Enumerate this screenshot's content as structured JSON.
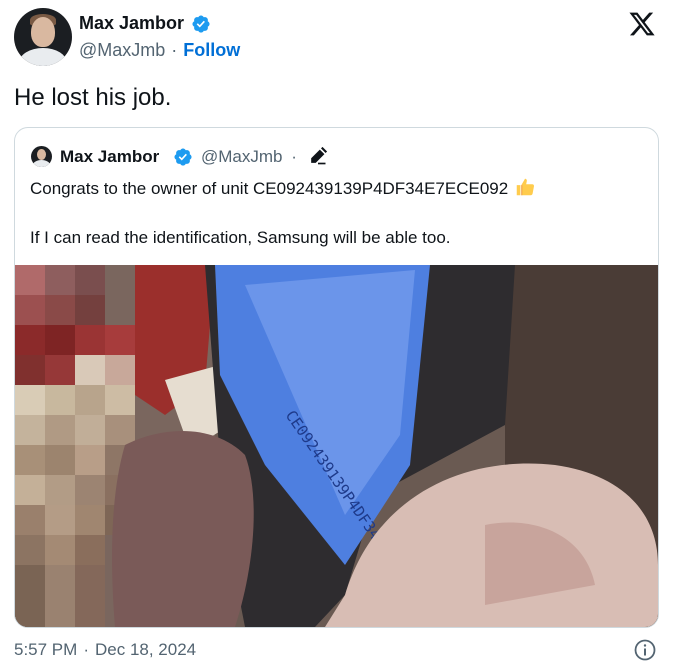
{
  "author": {
    "name": "Max Jambor",
    "handle": "@MaxJmb",
    "separator": "·",
    "follow_label": "Follow",
    "avatar_icon": "profile-photo",
    "verified_icon": "verified-badge-icon"
  },
  "tweet": {
    "text": "He lost his job."
  },
  "quoted": {
    "name": "Max Jambor",
    "handle": "@MaxJmb",
    "separator": "·",
    "edit_icon": "pencil-icon",
    "line1": "Congrats to the owner of unit CE092439139P4DF34E7ECE092",
    "emoji": "thumbs-up",
    "line2": "If I can read the identification, Samsung will be able too."
  },
  "footer": {
    "time": "5:57 PM",
    "separator": "·",
    "date": "Dec 18, 2024",
    "info_icon": "info-icon"
  },
  "colors": {
    "link_blue": "#006fd6",
    "verified_blue": "#1d9bf0",
    "secondary_text": "#536471",
    "border": "#cfd9de"
  }
}
